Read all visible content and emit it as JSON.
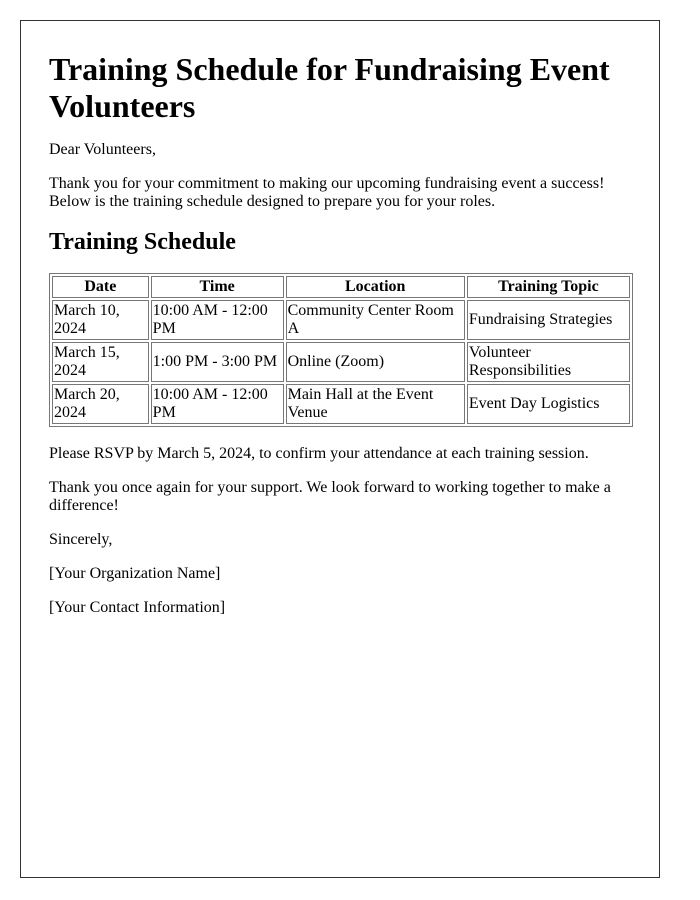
{
  "title": "Training Schedule for Fundraising Event Volunteers",
  "greeting": "Dear Volunteers,",
  "intro": "Thank you for your commitment to making our upcoming fundraising event a success! Below is the training schedule designed to prepare you for your roles.",
  "schedule_heading": "Training Schedule",
  "table": {
    "headers": [
      "Date",
      "Time",
      "Location",
      "Training Topic"
    ],
    "rows": [
      [
        "March 10, 2024",
        "10:00 AM - 12:00 PM",
        "Community Center Room A",
        "Fundraising Strategies"
      ],
      [
        "March 15, 2024",
        "1:00 PM - 3:00 PM",
        "Online (Zoom)",
        "Volunteer Responsibilities"
      ],
      [
        "March 20, 2024",
        "10:00 AM - 12:00 PM",
        "Main Hall at the Event Venue",
        "Event Day Logistics"
      ]
    ]
  },
  "rsvp": "Please RSVP by March 5, 2024, to confirm your attendance at each training session.",
  "closing": "Thank you once again for your support. We look forward to working together to make a difference!",
  "signoff": "Sincerely,",
  "organization": "[Your Organization Name]",
  "contact": "[Your Contact Information]"
}
